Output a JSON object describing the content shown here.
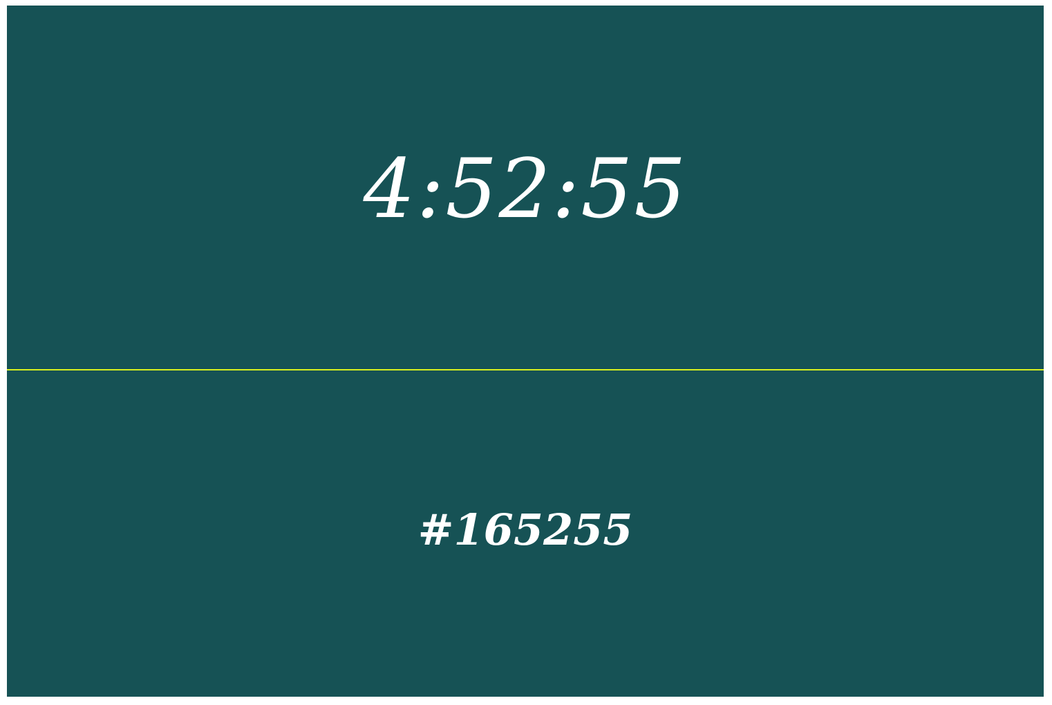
{
  "time": {
    "value": "4:52:55"
  },
  "color": {
    "hex_label": "#165255",
    "background": "#165255",
    "divider": "#d8f01e",
    "text": "#ffffff"
  }
}
